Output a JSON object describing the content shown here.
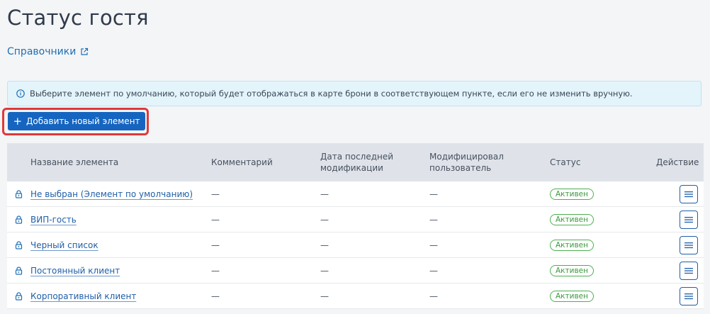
{
  "page": {
    "title": "Статус гостя",
    "breadcrumb": "Справочники"
  },
  "info": {
    "text": "Выберите элемент по умолчанию, который будет отображаться в карте брони в соответствующем пункте, если его не изменить вручную."
  },
  "toolbar": {
    "add_label": "Добавить новый элемент",
    "add_icon": "plus"
  },
  "colors": {
    "accent": "#1565c0",
    "link": "#1f5fa8",
    "status_active": "#4caf50",
    "highlight": "#e0393b"
  },
  "table": {
    "columns": {
      "name": "Название элемента",
      "comment": "Комментарий",
      "date": "Дата последней модификации",
      "user": "Модифицировал пользователь",
      "status": "Статус",
      "action": "Действие"
    },
    "rows": [
      {
        "name": "Не выбран (Элемент по умолчанию)",
        "comment": "—",
        "date": "—",
        "user": "—",
        "status": "Активен"
      },
      {
        "name": "ВИП-гость",
        "comment": "—",
        "date": "—",
        "user": "—",
        "status": "Активен"
      },
      {
        "name": "Черный список",
        "comment": "—",
        "date": "—",
        "user": "—",
        "status": "Активен"
      },
      {
        "name": "Постоянный клиент",
        "comment": "—",
        "date": "—",
        "user": "—",
        "status": "Активен"
      },
      {
        "name": "Корпоративный клиент",
        "comment": "—",
        "date": "—",
        "user": "—",
        "status": "Активен"
      }
    ]
  }
}
